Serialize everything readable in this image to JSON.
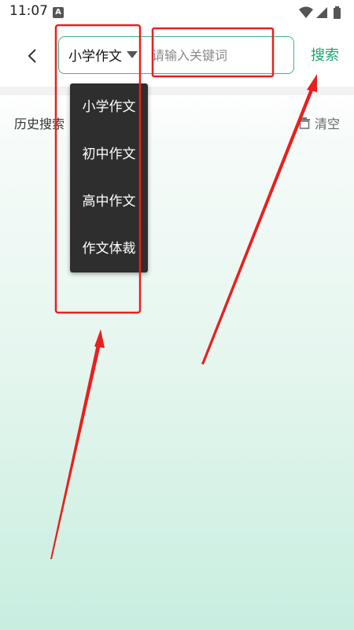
{
  "status_bar": {
    "time": "11:07",
    "notification_icon": "a-icon",
    "wifi_icon": "wifi-icon",
    "signal_icon": "signal-icon",
    "battery_icon": "battery-icon"
  },
  "header": {
    "back_icon": "chevron-left-icon",
    "category_selected": "小学作文",
    "search_placeholder": "请输入关键词",
    "search_button": "搜索"
  },
  "history": {
    "title": "历史搜索",
    "clear_label": "清空"
  },
  "dropdown": {
    "options": [
      "小学作文",
      "初中作文",
      "高中作文",
      "作文体裁"
    ]
  },
  "colors": {
    "accent": "#1aa56e",
    "search_border": "#3db48a",
    "annotation": "#e8201e",
    "dropdown_bg": "#2e2e2e"
  }
}
